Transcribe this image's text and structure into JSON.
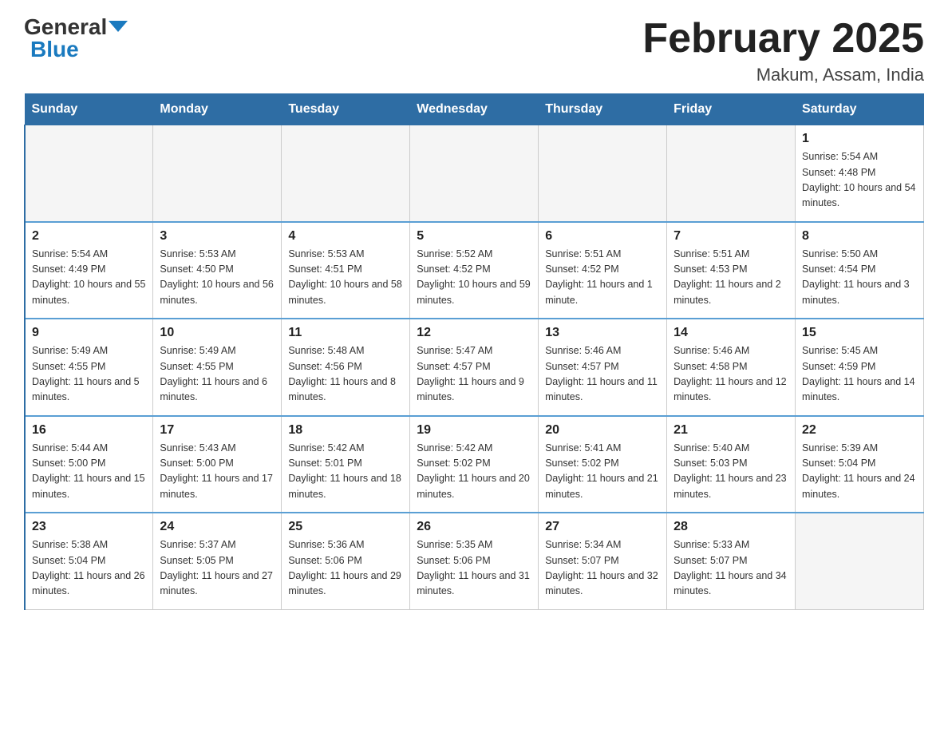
{
  "header": {
    "logo_general": "General",
    "logo_blue": "Blue",
    "month_title": "February 2025",
    "location": "Makum, Assam, India"
  },
  "days_of_week": [
    "Sunday",
    "Monday",
    "Tuesday",
    "Wednesday",
    "Thursday",
    "Friday",
    "Saturday"
  ],
  "weeks": [
    [
      {
        "day": "",
        "sunrise": "",
        "sunset": "",
        "daylight": "",
        "empty": true
      },
      {
        "day": "",
        "sunrise": "",
        "sunset": "",
        "daylight": "",
        "empty": true
      },
      {
        "day": "",
        "sunrise": "",
        "sunset": "",
        "daylight": "",
        "empty": true
      },
      {
        "day": "",
        "sunrise": "",
        "sunset": "",
        "daylight": "",
        "empty": true
      },
      {
        "day": "",
        "sunrise": "",
        "sunset": "",
        "daylight": "",
        "empty": true
      },
      {
        "day": "",
        "sunrise": "",
        "sunset": "",
        "daylight": "",
        "empty": true
      },
      {
        "day": "1",
        "sunrise": "Sunrise: 5:54 AM",
        "sunset": "Sunset: 4:48 PM",
        "daylight": "Daylight: 10 hours and 54 minutes.",
        "empty": false
      }
    ],
    [
      {
        "day": "2",
        "sunrise": "Sunrise: 5:54 AM",
        "sunset": "Sunset: 4:49 PM",
        "daylight": "Daylight: 10 hours and 55 minutes.",
        "empty": false
      },
      {
        "day": "3",
        "sunrise": "Sunrise: 5:53 AM",
        "sunset": "Sunset: 4:50 PM",
        "daylight": "Daylight: 10 hours and 56 minutes.",
        "empty": false
      },
      {
        "day": "4",
        "sunrise": "Sunrise: 5:53 AM",
        "sunset": "Sunset: 4:51 PM",
        "daylight": "Daylight: 10 hours and 58 minutes.",
        "empty": false
      },
      {
        "day": "5",
        "sunrise": "Sunrise: 5:52 AM",
        "sunset": "Sunset: 4:52 PM",
        "daylight": "Daylight: 10 hours and 59 minutes.",
        "empty": false
      },
      {
        "day": "6",
        "sunrise": "Sunrise: 5:51 AM",
        "sunset": "Sunset: 4:52 PM",
        "daylight": "Daylight: 11 hours and 1 minute.",
        "empty": false
      },
      {
        "day": "7",
        "sunrise": "Sunrise: 5:51 AM",
        "sunset": "Sunset: 4:53 PM",
        "daylight": "Daylight: 11 hours and 2 minutes.",
        "empty": false
      },
      {
        "day": "8",
        "sunrise": "Sunrise: 5:50 AM",
        "sunset": "Sunset: 4:54 PM",
        "daylight": "Daylight: 11 hours and 3 minutes.",
        "empty": false
      }
    ],
    [
      {
        "day": "9",
        "sunrise": "Sunrise: 5:49 AM",
        "sunset": "Sunset: 4:55 PM",
        "daylight": "Daylight: 11 hours and 5 minutes.",
        "empty": false
      },
      {
        "day": "10",
        "sunrise": "Sunrise: 5:49 AM",
        "sunset": "Sunset: 4:55 PM",
        "daylight": "Daylight: 11 hours and 6 minutes.",
        "empty": false
      },
      {
        "day": "11",
        "sunrise": "Sunrise: 5:48 AM",
        "sunset": "Sunset: 4:56 PM",
        "daylight": "Daylight: 11 hours and 8 minutes.",
        "empty": false
      },
      {
        "day": "12",
        "sunrise": "Sunrise: 5:47 AM",
        "sunset": "Sunset: 4:57 PM",
        "daylight": "Daylight: 11 hours and 9 minutes.",
        "empty": false
      },
      {
        "day": "13",
        "sunrise": "Sunrise: 5:46 AM",
        "sunset": "Sunset: 4:57 PM",
        "daylight": "Daylight: 11 hours and 11 minutes.",
        "empty": false
      },
      {
        "day": "14",
        "sunrise": "Sunrise: 5:46 AM",
        "sunset": "Sunset: 4:58 PM",
        "daylight": "Daylight: 11 hours and 12 minutes.",
        "empty": false
      },
      {
        "day": "15",
        "sunrise": "Sunrise: 5:45 AM",
        "sunset": "Sunset: 4:59 PM",
        "daylight": "Daylight: 11 hours and 14 minutes.",
        "empty": false
      }
    ],
    [
      {
        "day": "16",
        "sunrise": "Sunrise: 5:44 AM",
        "sunset": "Sunset: 5:00 PM",
        "daylight": "Daylight: 11 hours and 15 minutes.",
        "empty": false
      },
      {
        "day": "17",
        "sunrise": "Sunrise: 5:43 AM",
        "sunset": "Sunset: 5:00 PM",
        "daylight": "Daylight: 11 hours and 17 minutes.",
        "empty": false
      },
      {
        "day": "18",
        "sunrise": "Sunrise: 5:42 AM",
        "sunset": "Sunset: 5:01 PM",
        "daylight": "Daylight: 11 hours and 18 minutes.",
        "empty": false
      },
      {
        "day": "19",
        "sunrise": "Sunrise: 5:42 AM",
        "sunset": "Sunset: 5:02 PM",
        "daylight": "Daylight: 11 hours and 20 minutes.",
        "empty": false
      },
      {
        "day": "20",
        "sunrise": "Sunrise: 5:41 AM",
        "sunset": "Sunset: 5:02 PM",
        "daylight": "Daylight: 11 hours and 21 minutes.",
        "empty": false
      },
      {
        "day": "21",
        "sunrise": "Sunrise: 5:40 AM",
        "sunset": "Sunset: 5:03 PM",
        "daylight": "Daylight: 11 hours and 23 minutes.",
        "empty": false
      },
      {
        "day": "22",
        "sunrise": "Sunrise: 5:39 AM",
        "sunset": "Sunset: 5:04 PM",
        "daylight": "Daylight: 11 hours and 24 minutes.",
        "empty": false
      }
    ],
    [
      {
        "day": "23",
        "sunrise": "Sunrise: 5:38 AM",
        "sunset": "Sunset: 5:04 PM",
        "daylight": "Daylight: 11 hours and 26 minutes.",
        "empty": false
      },
      {
        "day": "24",
        "sunrise": "Sunrise: 5:37 AM",
        "sunset": "Sunset: 5:05 PM",
        "daylight": "Daylight: 11 hours and 27 minutes.",
        "empty": false
      },
      {
        "day": "25",
        "sunrise": "Sunrise: 5:36 AM",
        "sunset": "Sunset: 5:06 PM",
        "daylight": "Daylight: 11 hours and 29 minutes.",
        "empty": false
      },
      {
        "day": "26",
        "sunrise": "Sunrise: 5:35 AM",
        "sunset": "Sunset: 5:06 PM",
        "daylight": "Daylight: 11 hours and 31 minutes.",
        "empty": false
      },
      {
        "day": "27",
        "sunrise": "Sunrise: 5:34 AM",
        "sunset": "Sunset: 5:07 PM",
        "daylight": "Daylight: 11 hours and 32 minutes.",
        "empty": false
      },
      {
        "day": "28",
        "sunrise": "Sunrise: 5:33 AM",
        "sunset": "Sunset: 5:07 PM",
        "daylight": "Daylight: 11 hours and 34 minutes.",
        "empty": false
      },
      {
        "day": "",
        "sunrise": "",
        "sunset": "",
        "daylight": "",
        "empty": true
      }
    ]
  ]
}
